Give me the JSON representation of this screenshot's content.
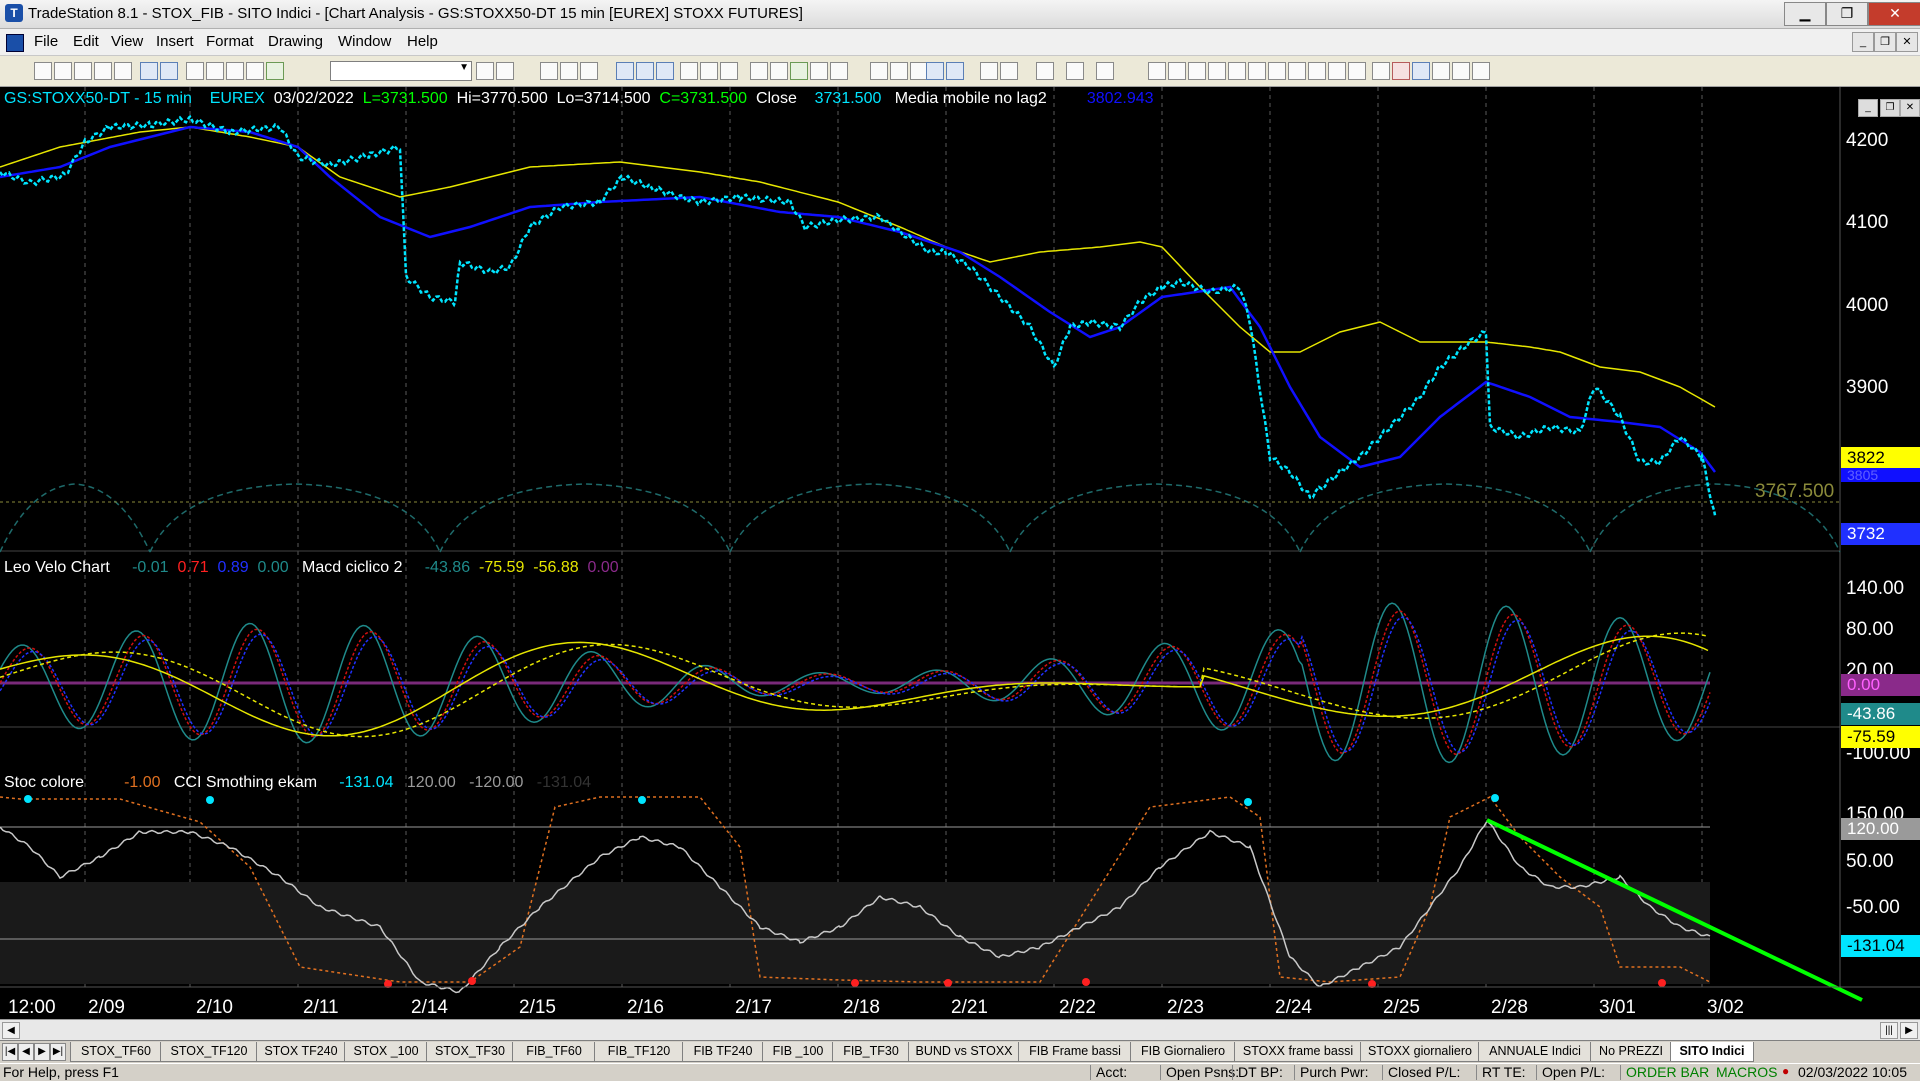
{
  "window": {
    "title": "TradeStation 8.1 - STOX_FIB - SITO Indici - [Chart Analysis - GS:STOXX50-DT  15 min  [EUREX] STOXX FUTURES]",
    "minimize_icon": "minimize-icon",
    "maximize_icon": "restore-icon",
    "close_icon": "close-icon"
  },
  "menu": {
    "items": [
      "File",
      "Edit",
      "View",
      "Insert",
      "Format",
      "Drawing",
      "Window",
      "Help"
    ]
  },
  "toolbar": {
    "dropdown_value": ""
  },
  "chart": {
    "header": {
      "symbol": "GS:STOXX50-DT - 15 min",
      "exchange": "EUREX",
      "date": "03/02/2022",
      "last": "L=3731.500",
      "high": "Hi=3770.500",
      "low": "Lo=3714.500",
      "close_eq": "C=3731.500",
      "close_label": "Close",
      "close_value": "3731.500",
      "ma_label": "Media mobile no lag2",
      "ma_value": "3802.943"
    },
    "colors": {
      "price": "#00e5ff",
      "ma_blue": "#1010ff",
      "ma_yellow": "#e6e600",
      "cycle": "#1e6a6a",
      "trend": "#00ff00"
    },
    "price_axis": {
      "ticks": [
        "4200",
        "4100",
        "4000",
        "3900"
      ],
      "ylim": [
        3690,
        4250
      ]
    },
    "price_markers": {
      "yellow": "3822",
      "blue": "3805",
      "last": "3732",
      "level": "3767.500"
    },
    "panel2": {
      "name1": "Leo Velo Chart",
      "v1a": "-0.01",
      "v1b": "0.71",
      "v1c": "0.89",
      "v1d": "0.00",
      "name2": "Macd ciclico 2",
      "v2a": "-43.86",
      "v2b": "-75.59",
      "v2c": "-56.88",
      "v2d": "0.00",
      "ticks": [
        "140.00",
        "80.00",
        "20.00",
        "-100.00"
      ],
      "markers": {
        "zero": "0.00",
        "teal": "-43.86",
        "yellow": "-75.59"
      }
    },
    "panel3": {
      "name1": "Stoc colore",
      "v1": "-1.00",
      "name2": "CCI Smothing ekam",
      "v2a": "-131.04",
      "v2b": "120.00",
      "v2c": "-120.00",
      "v2d": "-131.04",
      "ticks": [
        "150.00",
        "50.00",
        "-50.00"
      ],
      "markers": {
        "top": "120.00",
        "last": "-131.04"
      }
    },
    "dates": [
      "12:00",
      "2/09",
      "2/10",
      "2/11",
      "2/14",
      "2/15",
      "2/16",
      "2/17",
      "2/18",
      "2/21",
      "2/22",
      "2/23",
      "2/24",
      "2/25",
      "2/28",
      "3/01",
      "3/02"
    ]
  },
  "tabs": {
    "items": [
      "STOX_TF60",
      "STOX_TF120",
      "STOX TF240",
      "STOX _100",
      "STOX_TF30",
      "FIB_TF60",
      "FIB_TF120",
      "FIB TF240",
      "FIB _100",
      "FIB_TF30",
      "BUND vs STOXX",
      "FIB Frame bassi",
      "FIB Giornaliero",
      "STOXX frame bassi",
      "STOXX giornaliero",
      "ANNUALE Indici",
      "No PREZZI",
      "SITO Indici"
    ],
    "active": "SITO Indici"
  },
  "status": {
    "help": "For Help, press F1",
    "acct": "Acct:",
    "open_psns": "Open Psns:",
    "dt_bp": "DT BP:",
    "purch_pwr": "Purch Pwr:",
    "closed_pl": "Closed P/L:",
    "rt_te": "RT TE:",
    "open_pl": "Open P/L:",
    "order_bar": "ORDER BAR",
    "macros": "MACROS",
    "datetime": "02/03/2022 10:05"
  }
}
